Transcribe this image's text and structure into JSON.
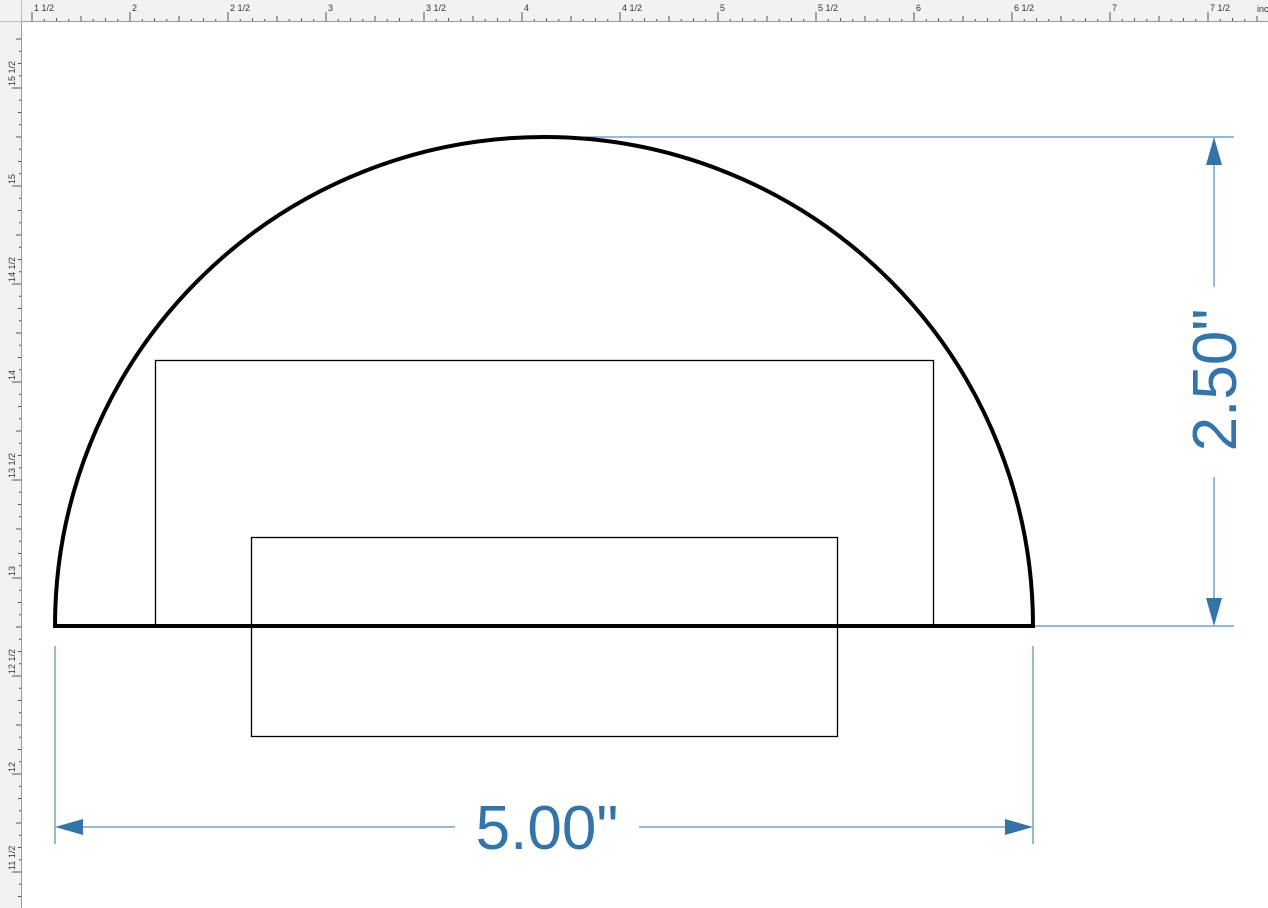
{
  "ruler": {
    "unit_label": "inc",
    "horizontal_labels": [
      "1 1/2",
      "2",
      "2 1/2",
      "3",
      "3 1/2",
      "4",
      "4 1/2",
      "5",
      "5 1/2",
      "6",
      "6 1/2",
      "7",
      "7 1/2"
    ],
    "vertical_labels": [
      "15 1/2",
      "15",
      "14 1/2",
      "14",
      "13 1/2",
      "13",
      "12 1/2",
      "12",
      "11 1/2"
    ]
  },
  "dimensions": {
    "width_label": "5.00\"",
    "height_label": "2.50\""
  },
  "colors": {
    "dimension": "#3574a8",
    "outline": "#000000",
    "ruler_bg": "#f2f2f2"
  }
}
